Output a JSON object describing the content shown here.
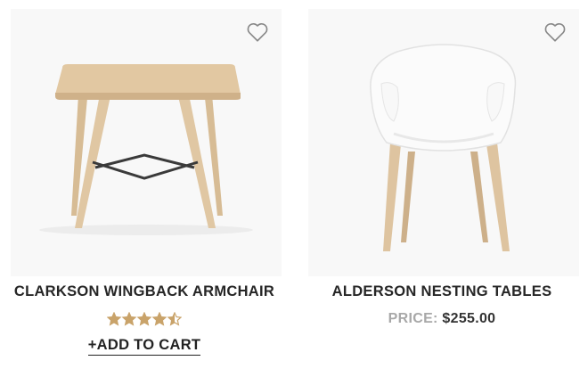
{
  "products": [
    {
      "title": "CLARKSON WINGBACK ARMCHAIR",
      "rating": 4.5,
      "rating_max": 5,
      "add_to_cart_label": "+ADD TO CART",
      "image_icon": "wooden-table-image"
    },
    {
      "title": "ALDERSON NESTING TABLES",
      "price_label": "PRICE:",
      "price_value": "$255.00",
      "image_icon": "white-chair-image"
    }
  ],
  "colors": {
    "star": "#c9a36a",
    "card_bg": "#f8f8f8",
    "price_label": "#a8a8a8",
    "wood": "#dcc3a0"
  },
  "icons": [
    "heart-icon",
    "star-icon"
  ]
}
